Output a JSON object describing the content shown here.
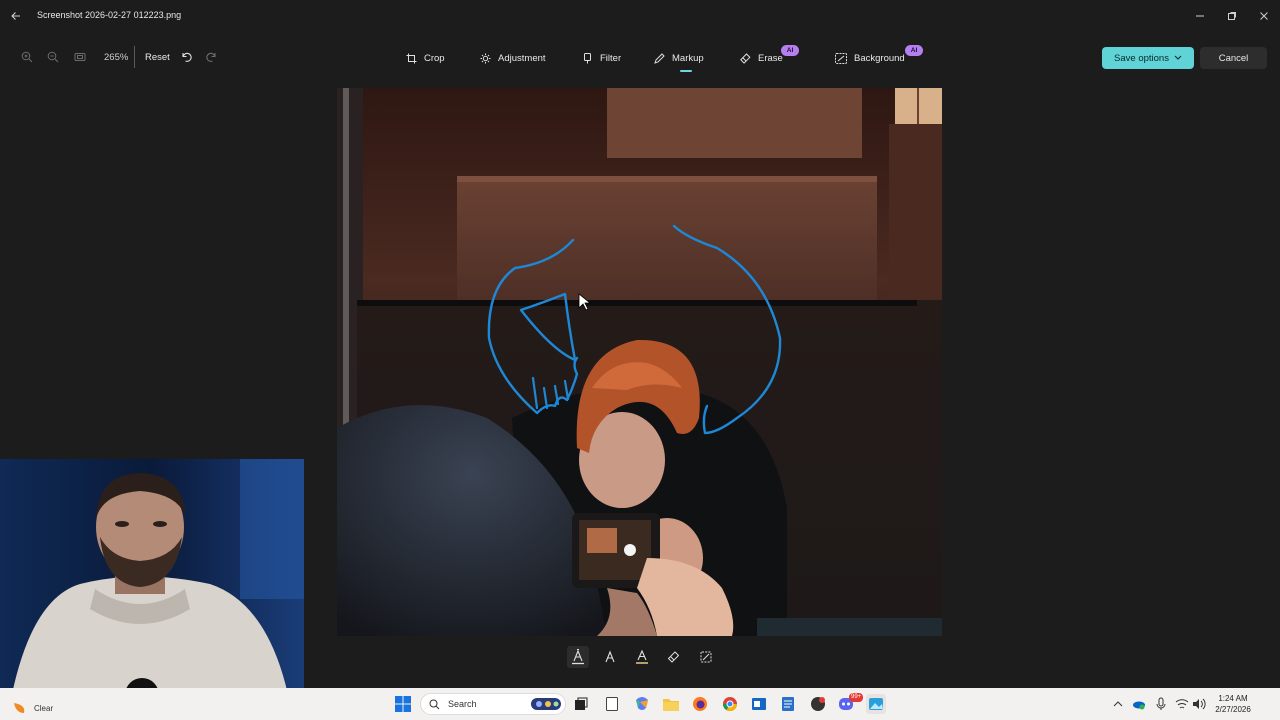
{
  "window": {
    "title": "Screenshot 2026-02-27 012223.png"
  },
  "toolbar": {
    "zoom_level": "265%",
    "reset_label": "Reset",
    "tabs": [
      {
        "label": "Crop",
        "icon": "crop-icon"
      },
      {
        "label": "Adjustment",
        "icon": "brightness-icon"
      },
      {
        "label": "Filter",
        "icon": "filter-icon"
      },
      {
        "label": "Markup",
        "icon": "pen-icon",
        "active": true
      },
      {
        "label": "Erase",
        "icon": "eraser-icon",
        "badge": "AI"
      },
      {
        "label": "Background",
        "icon": "background-icon",
        "badge": "AI"
      }
    ],
    "save_label": "Save options",
    "cancel_label": "Cancel"
  },
  "markup_tools": [
    {
      "name": "ballpoint-pen",
      "active": true
    },
    {
      "name": "pencil"
    },
    {
      "name": "highlighter"
    },
    {
      "name": "eraser"
    },
    {
      "name": "clear-eraser"
    }
  ],
  "taskbar": {
    "weather": "Clear",
    "search_placeholder": "Search",
    "time": "1:24 AM",
    "date": "2/27/2026",
    "discord_badge": "99+"
  },
  "colors": {
    "accent": "#5fd3d6",
    "ai_badge": "#b67ff0",
    "markup_ink": "#1e88d6"
  }
}
